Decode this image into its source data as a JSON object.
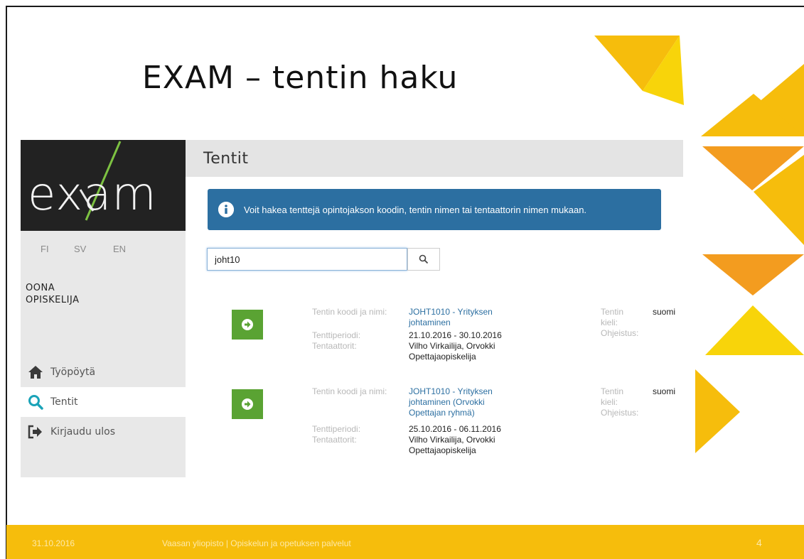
{
  "slide": {
    "title": "EXAM – tentin haku",
    "footer_date": "31.10.2016",
    "footer_org": "Vaasan yliopisto | Opiskelun ja opetuksen palvelut",
    "page_number": "4",
    "accent_color": "#f6bd0c"
  },
  "app": {
    "logo_text": "exam",
    "languages": [
      "FI",
      "SV",
      "EN"
    ],
    "user_name_line1": "OONA",
    "user_name_line2": "OPISKELIJA",
    "nav": [
      {
        "label": "Työpöytä",
        "icon": "home-icon"
      },
      {
        "label": "Tentit",
        "icon": "search-icon"
      },
      {
        "label": "Kirjaudu ulos",
        "icon": "logout-icon"
      }
    ],
    "page_title": "Tentit",
    "info_text": "Voit hakea tenttejä opintojakson koodin, tentin nimen tai tentaattorin nimen mukaan.",
    "search_value": "joht10",
    "results": [
      {
        "label_code": "Tentin koodi ja nimi:",
        "code_name": "JOHT1010 - Yrityksen johtaminen",
        "code_name_lines": [
          "JOHT1010 - Yrityksen",
          "johtaminen"
        ],
        "label_period": "Tenttiperiodi:",
        "period": "21.10.2016 - 30.10.2016",
        "label_examiners": "Tentaattorit:",
        "examiners_lines": [
          "Vilho Virkailija, Orvokki",
          "Opettajaopiskelija"
        ],
        "label_lang": "Tentin kieli:",
        "label_lang_lines": [
          "Tentin",
          "kieli:"
        ],
        "language": "suomi",
        "label_instructions": "Ohjeistus:"
      },
      {
        "label_code": "Tentin koodi ja nimi:",
        "code_name": "JOHT1010 - Yrityksen johtaminen (Orvokki Opettajan ryhmä)",
        "code_name_lines": [
          "JOHT1010 - Yrityksen",
          "johtaminen (Orvokki",
          "Opettajan ryhmä)"
        ],
        "label_period": "Tenttiperiodi:",
        "period": "25.10.2016 - 06.11.2016",
        "label_examiners": "Tentaattorit:",
        "examiners_lines": [
          "Vilho Virkailija, Orvokki",
          "Opettajaopiskelija"
        ],
        "label_lang": "Tentin kieli:",
        "label_lang_lines": [
          "Tentin",
          "kieli:"
        ],
        "language": "suomi",
        "label_instructions": "Ohjeistus:"
      }
    ]
  }
}
